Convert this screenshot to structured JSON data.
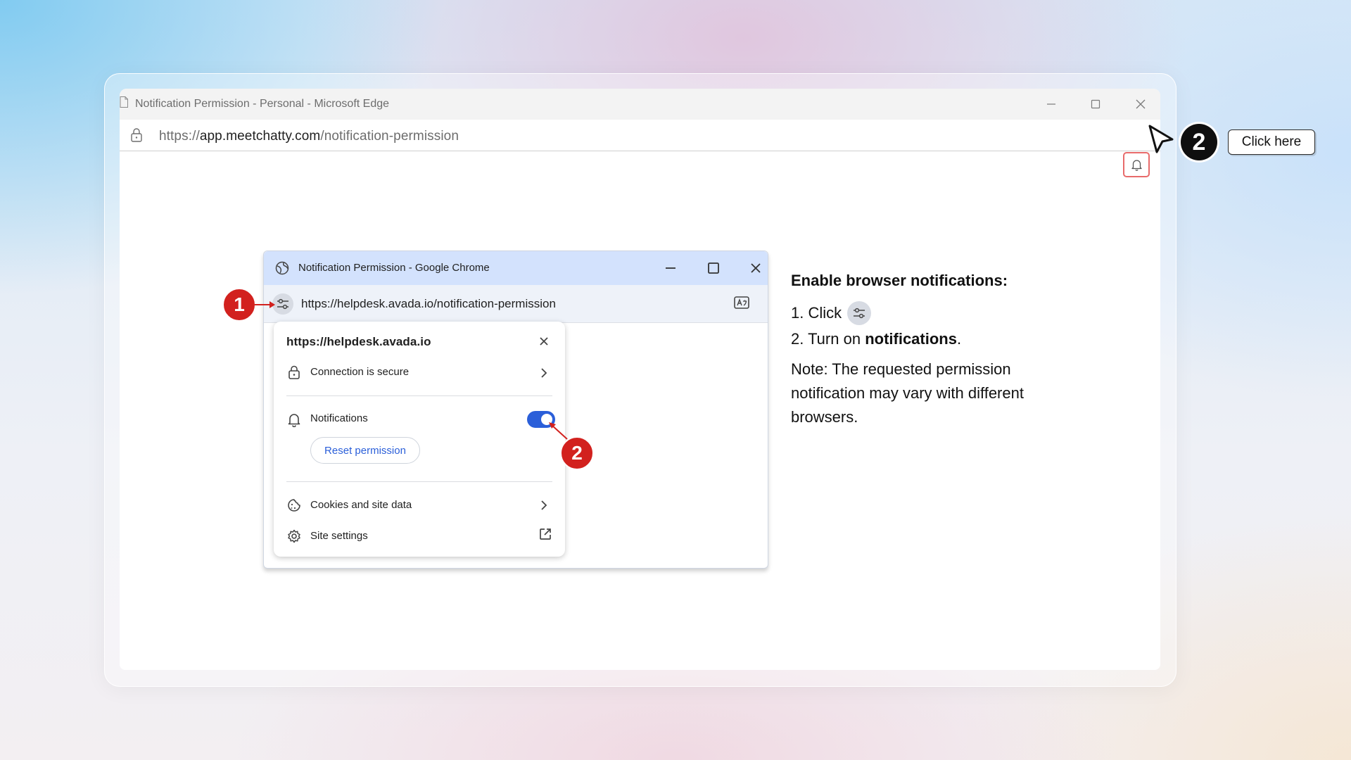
{
  "edge": {
    "title": "Notification Permission - Personal - Microsoft Edge",
    "url_scheme": "https://",
    "url_host": "app.meetchatty.com",
    "url_path": "/notification-permission"
  },
  "callout": {
    "step_number": "2",
    "click_here_label": "Click here"
  },
  "chrome": {
    "title": "Notification Permission - Google Chrome",
    "url": "https://helpdesk.avada.io/notification-permission",
    "popup": {
      "host": "https://helpdesk.avada.io",
      "connection_label": "Connection is secure",
      "notifications_label": "Notifications",
      "notifications_enabled": true,
      "reset_label": "Reset permission",
      "cookies_label": "Cookies and site data",
      "site_settings_label": "Site settings"
    },
    "badge_1": "1",
    "badge_2": "2"
  },
  "instructions": {
    "title": "Enable browser notifications:",
    "step1_prefix": "1. Click",
    "step2_prefix": "2. Turn on ",
    "step2_bold": "notifications",
    "step2_suffix": ".",
    "note": "Note: The requested permission notification may vary with different browsers."
  },
  "icons": {
    "edge_page": "document-icon",
    "lock": "lock-icon",
    "bell": "bell-icon",
    "cursor": "cursor-arrow-icon",
    "globe": "globe-icon",
    "tune": "tune-icon",
    "translate": "translate-icon"
  },
  "colors": {
    "badge_red": "#d2211e",
    "toggle_blue": "#2b5fd9",
    "chrome_titlebar": "#d3e2fd",
    "bell_highlight": "#e86b6b"
  }
}
